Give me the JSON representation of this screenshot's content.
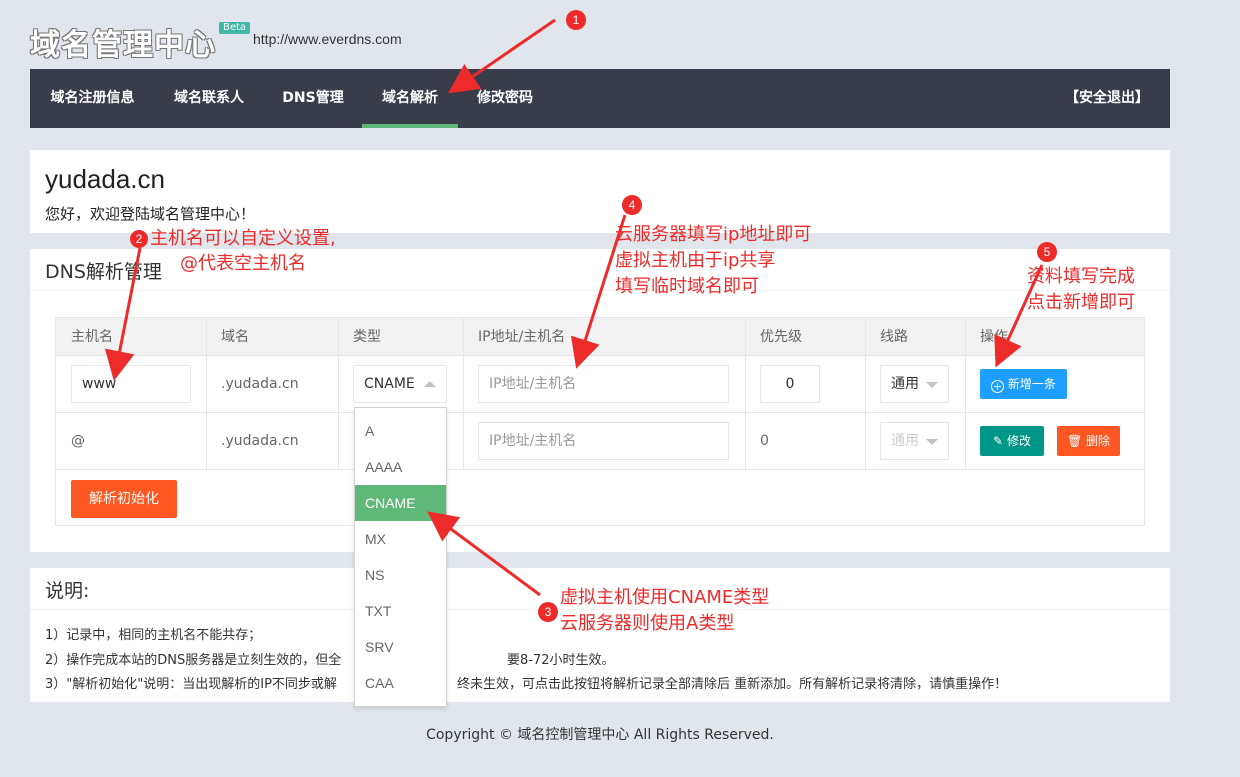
{
  "header": {
    "logo_text": "域名管理中心",
    "beta_label": "Beta",
    "site_url": "http://www.everdns.com"
  },
  "nav": {
    "items": [
      {
        "label": "域名注册信息"
      },
      {
        "label": "域名联系人"
      },
      {
        "label": "DNS管理"
      },
      {
        "label": "域名解析"
      },
      {
        "label": "修改密码"
      }
    ],
    "active_index": 3,
    "logout_label": "【安全退出】"
  },
  "domain_card": {
    "domain": "yudada.cn",
    "welcome": "您好，欢迎登陆域名管理中心！"
  },
  "dns": {
    "section_title": "DNS解析管理",
    "columns": [
      "主机名",
      "域名",
      "类型",
      "IP地址/主机名",
      "优先级",
      "线路",
      "操作"
    ],
    "rows": [
      {
        "host": "www",
        "domain": ".yudada.cn",
        "type": "CNAME",
        "ip_placeholder": "IP地址/主机名",
        "priority": "0",
        "line": "通用",
        "action": "新增一条"
      },
      {
        "host": "@",
        "domain": ".yudada.cn",
        "ip_placeholder": "IP地址/主机名",
        "priority": "0",
        "line": "通用",
        "edit_label": "修改",
        "delete_label": "删除"
      }
    ],
    "type_options": [
      "A",
      "AAAA",
      "CNAME",
      "MX",
      "NS",
      "TXT",
      "SRV",
      "CAA"
    ],
    "selected_type": "CNAME",
    "init_button": "解析初始化"
  },
  "notes": {
    "title": "说明:",
    "items": [
      "1）记录中，相同的主机名不能共存；",
      "2）操作完成本站的DNS服务器是立刻生效的，但全",
      "要8-72小时生效。",
      "3）\"解析初始化\"说明：当出现解析的IP不同步或解",
      "终未生效，可点击此按钮将解析记录全部清除后 重新添加。所有解析记录将清除，请慎重操作！"
    ]
  },
  "footer": {
    "copyright": "Copyright © 域名控制管理中心 All Rights Reserved."
  },
  "annotations": {
    "colors": {
      "annotation": "#ee2b2b",
      "nav_bg": "#393d49",
      "nav_active": "#5fb878",
      "btn_blue": "#1e9fff",
      "btn_green": "#009688",
      "btn_orange": "#ff5722"
    },
    "labels": [
      {
        "num": "1"
      },
      {
        "num": "2",
        "lines": [
          "主机名可以自定义设置,",
          "@代表空主机名"
        ]
      },
      {
        "num": "3",
        "lines": [
          "虚拟主机使用CNAME类型",
          "云服务器则使用A类型"
        ]
      },
      {
        "num": "4",
        "lines": [
          "云服务器填写ip地址即可",
          "虚拟主机由于ip共享",
          "填写临时域名即可"
        ]
      },
      {
        "num": "5",
        "lines": [
          "资料填写完成",
          "点击新增即可"
        ]
      }
    ]
  }
}
